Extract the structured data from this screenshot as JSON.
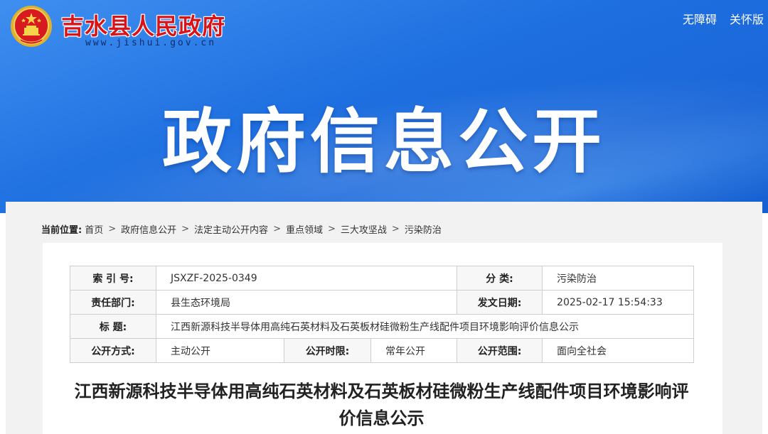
{
  "header": {
    "site_title": "吉水县人民政府",
    "site_url": "www.jishui.gov.cn",
    "links": [
      "无障碍",
      "关怀版"
    ],
    "banner_title": "政府信息公开"
  },
  "breadcrumb": {
    "label": "当前位置:",
    "items": [
      "首页",
      "政府信息公开",
      "法定主动公开内容",
      "重点领域",
      "三大攻坚战",
      "污染防治"
    ]
  },
  "meta": {
    "index_label": "索 引 号:",
    "index_value": "JSXZF-2025-0349",
    "category_label": "分    类:",
    "category_value": "污染防治",
    "dept_label": "责任部门:",
    "dept_value": "县生态环境局",
    "date_label": "发文日期:",
    "date_value": "2025-02-17 15:54:33",
    "title_label": "标    题:",
    "title_value": "江西新源科技半导体用高纯石英材料及石英板材硅微粉生产线配件项目环境影响评价信息公示",
    "method_label": "公开方式:",
    "method_value": "主动公开",
    "period_label": "公开时限:",
    "period_value": "常年公开",
    "scope_label": "公开范围:",
    "scope_value": "面向全社会"
  },
  "document": {
    "title": "江西新源科技半导体用高纯石英材料及石英板材硅微粉生产线配件项目环境影响评价信息公示"
  },
  "colors": {
    "banner": "#1e6fe0",
    "title_red": "#d8141b",
    "panel_gray": "#f2f2f2"
  }
}
